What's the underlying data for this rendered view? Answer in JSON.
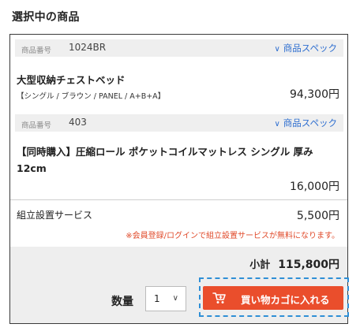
{
  "page": {
    "title": "選択中の商品"
  },
  "items": [
    {
      "number_label": "商品番号",
      "number": "1024BR",
      "spec_link": "商品スペック",
      "name": "大型収納チェストベッド",
      "variant": "【シングル / ブラウン / PANEL / A+B+A】",
      "price": "94,300円"
    },
    {
      "number_label": "商品番号",
      "number": "403",
      "spec_link": "商品スペック",
      "name": "【同時購入】圧縮ロール ポケットコイルマットレス シングル 厚み12cm",
      "price": "16,000円"
    }
  ],
  "service": {
    "label": "組立設置サービス",
    "price": "5,500円",
    "note": "※会員登録/ログインで組立設置サービスが無料になります。"
  },
  "footer": {
    "subtotal_label": "小計",
    "subtotal_value": "115,800円",
    "qty_label": "数量",
    "qty_value": "1",
    "cart_button": "買い物カゴに入れる"
  },
  "colors": {
    "accent": "#ea4e2c",
    "link": "#2f6fd0",
    "note": "#e04a2a",
    "focus": "#2f8fd6"
  },
  "icons": {
    "spec_chevron": "chevron-down-icon",
    "qty_chevron": "chevron-down-icon",
    "cart": "cart-icon"
  }
}
